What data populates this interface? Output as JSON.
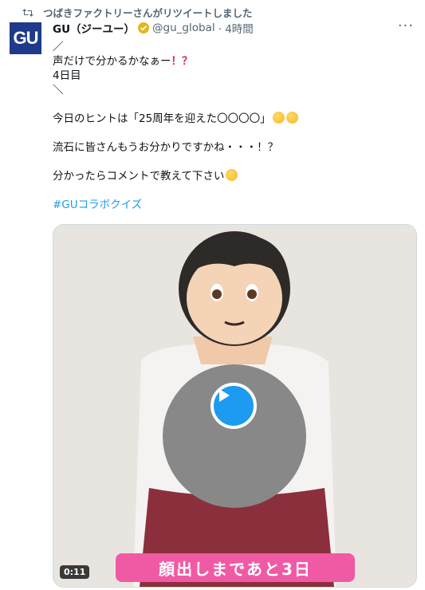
{
  "retweet": {
    "text": "つばきファクトリーさんがリツイートしました"
  },
  "author": {
    "avatar_text": "GU",
    "name": "GU（ジーユー）",
    "handle": "@gu_global",
    "time": "· 4時間"
  },
  "tweet": {
    "line1": "／",
    "line2": "声だけで分かるかなぁー",
    "line2_marks": "！？",
    "line3": "4日目",
    "line4": "＼",
    "line5": "今日のヒントは「25周年を迎えた〇〇〇〇」",
    "line6": "流石に皆さんもうお分かりですかね・・・！？",
    "line7": "分かったらコメントで教えて下さい",
    "hashtag": "#GUコラボクイズ"
  },
  "media": {
    "duration": "0:11",
    "banner": "顔出しまであと3日"
  },
  "icons": {
    "retweet": "retweet-icon",
    "verified": "verified-badge-icon",
    "more": "more-icon",
    "play": "play-icon"
  },
  "colors": {
    "accent": "#1d9bf0",
    "banner": "#f05aa5",
    "avatar": "#1f3a8a",
    "badge": "#e2b719"
  }
}
